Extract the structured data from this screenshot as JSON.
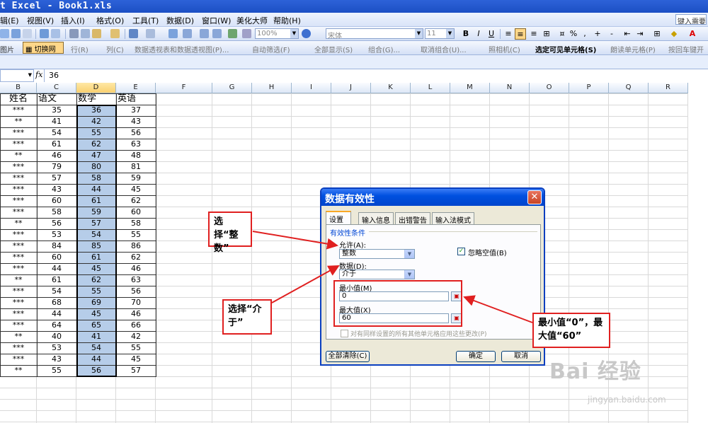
{
  "app": {
    "title": "t Excel - Book1.xls",
    "help_placeholder": "键入需要"
  },
  "menu": [
    "辑(E)",
    "视图(V)",
    "插入(I)",
    "格式(O)",
    "工具(T)",
    "数据(D)",
    "窗口(W)",
    "美化大师",
    "帮助(H)"
  ],
  "toolbar": {
    "zoom": "100%",
    "font": "宋体",
    "font_size": "11",
    "bold": "B",
    "italic": "I",
    "underline": "U"
  },
  "toolbar2": {
    "items": [
      "图片",
      "切换网格",
      "行(R)",
      "列(C)",
      "数据透视表和数据透视图(P)...",
      "自动筛选(F)",
      "全部显示(S)",
      "组合(G)...",
      "取消组合(U)...",
      "照相机(C)",
      "选定可见单元格(S)",
      "朗读单元格(P)",
      "按回车键开"
    ]
  },
  "formula_bar": {
    "fx": "fx",
    "value": "36"
  },
  "columns": [
    "B",
    "C",
    "D",
    "E",
    "F",
    "G",
    "H",
    "I",
    "J",
    "K",
    "L",
    "M",
    "N",
    "O",
    "P",
    "Q",
    "R"
  ],
  "table": {
    "headers": [
      "姓名",
      "语文",
      "数学",
      "英语"
    ],
    "rows": [
      [
        "***",
        "35",
        "36",
        "37"
      ],
      [
        "**",
        "41",
        "42",
        "43"
      ],
      [
        "***",
        "54",
        "55",
        "56"
      ],
      [
        "***",
        "61",
        "62",
        "63"
      ],
      [
        "**",
        "46",
        "47",
        "48"
      ],
      [
        "***",
        "79",
        "80",
        "81"
      ],
      [
        "***",
        "57",
        "58",
        "59"
      ],
      [
        "***",
        "43",
        "44",
        "45"
      ],
      [
        "***",
        "60",
        "61",
        "62"
      ],
      [
        "***",
        "58",
        "59",
        "60"
      ],
      [
        "**",
        "56",
        "57",
        "58"
      ],
      [
        "***",
        "53",
        "54",
        "55"
      ],
      [
        "***",
        "84",
        "85",
        "86"
      ],
      [
        "***",
        "60",
        "61",
        "62"
      ],
      [
        "***",
        "44",
        "45",
        "46"
      ],
      [
        "**",
        "61",
        "62",
        "63"
      ],
      [
        "***",
        "54",
        "55",
        "56"
      ],
      [
        "***",
        "68",
        "69",
        "70"
      ],
      [
        "***",
        "44",
        "45",
        "46"
      ],
      [
        "***",
        "64",
        "65",
        "66"
      ],
      [
        "**",
        "40",
        "41",
        "42"
      ],
      [
        "***",
        "53",
        "54",
        "55"
      ],
      [
        "***",
        "43",
        "44",
        "45"
      ],
      [
        "**",
        "55",
        "56",
        "57"
      ]
    ]
  },
  "dialog": {
    "title": "数据有效性",
    "close": "✕",
    "tabs": [
      "设置",
      "输入信息",
      "出错警告",
      "输入法模式"
    ],
    "group": "有效性条件",
    "allow_label": "允许(A):",
    "allow_value": "整数",
    "ignore_blank": "忽略空值(B)",
    "data_label": "数据(D):",
    "data_value": "介于",
    "min_label": "最小值(M)",
    "min_value": "0",
    "max_label": "最大值(X)",
    "max_value": "60",
    "apply_all": "对有同样设置的所有其他单元格应用这些更改(P)",
    "clear_all": "全部清除(C)",
    "ok": "确定",
    "cancel": "取消"
  },
  "annotations": {
    "a1": "选择“整\n数”",
    "a2": "选择“介\n于”",
    "a3": "最小值“0”，最\n大值“60”"
  },
  "watermark": {
    "main": "Bai 经验",
    "sub": "jingyan.baidu.com"
  },
  "colors": {
    "title_bar": "#1c4fc4",
    "selection": "#b6cde9",
    "annotation": "#e02020",
    "dialog_bg": "#ece9d8"
  }
}
